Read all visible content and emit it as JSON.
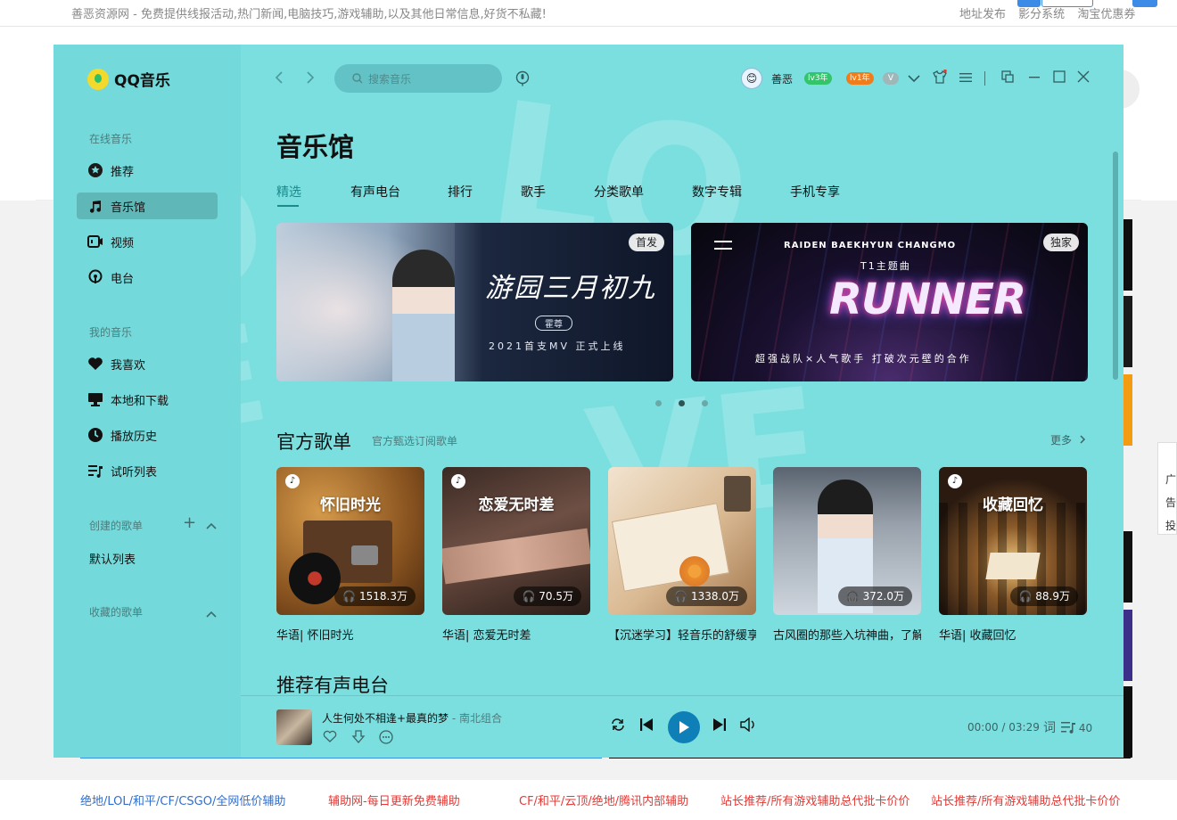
{
  "background": {
    "notice": "善恶资源网 - 免费提供线报活动,热门新闻,电脑技巧,游戏辅助,以及其他日常信息,好货不私藏!",
    "top_links": [
      "地址发布",
      "影分系统",
      "淘宝优惠券"
    ],
    "float_labels": [
      "广告",
      "投"
    ],
    "bottom_links": [
      {
        "text": "绝地/LOL/和平/CF/CSGO/全网低价辅助",
        "color": "#2f6fd1"
      },
      {
        "text": "辅助网-每日更新免费辅助",
        "color": "#e53935"
      },
      {
        "text": "CF/和平/云顶/绝地/腾讯内部辅助",
        "color": "#e53935"
      },
      {
        "text": "站长推荐/所有游戏辅助总代批卡价价",
        "color": "#e53935"
      },
      {
        "text": "站长推荐/所有游戏辅助总代批卡价价",
        "color": "#e53935"
      }
    ]
  },
  "app": {
    "name": "QQ音乐",
    "accent": "#1b8a8b",
    "window_bg": "#7bdfe0",
    "sidebar": {
      "section_online": "在线音乐",
      "online_items": [
        {
          "label": "推荐",
          "icon": "star-circle-icon"
        },
        {
          "label": "音乐馆",
          "icon": "music-note-icon",
          "active": true
        },
        {
          "label": "视频",
          "icon": "video-icon"
        },
        {
          "label": "电台",
          "icon": "radio-icon"
        }
      ],
      "section_mine": "我的音乐",
      "mine_items": [
        {
          "label": "我喜欢",
          "icon": "heart-icon"
        },
        {
          "label": "本地和下载",
          "icon": "monitor-icon"
        },
        {
          "label": "播放历史",
          "icon": "clock-icon"
        },
        {
          "label": "试听列表",
          "icon": "playlist-icon"
        }
      ],
      "section_created": "创建的歌单",
      "created_items": [
        "默认列表"
      ],
      "section_collected": "收藏的歌单"
    },
    "header": {
      "search_placeholder": "搜索音乐",
      "username": "善恶",
      "badges": [
        "lv3年",
        "lv1年"
      ]
    },
    "page_title": "音乐馆",
    "tabs": [
      "精选",
      "有声电台",
      "排行",
      "歌手",
      "分类歌单",
      "数字专辑",
      "手机专享"
    ],
    "banners": [
      {
        "tag": "首发",
        "title": "游园三月初九",
        "subtitle": "霍尊",
        "caption": "2021首支MV 正式上线"
      },
      {
        "tag": "独家",
        "artists": "RAIDEN   BAEKHYUN   CHANGMO",
        "subtitle": "T1主题曲",
        "title": "RUNNER",
        "caption": "超强战队×人气歌手  打破次元壁的合作"
      }
    ],
    "carousel_active": 1,
    "section_playlists": {
      "title": "官方歌单",
      "subtitle": "官方甄选订阅歌单",
      "more": "更多"
    },
    "playlists": [
      {
        "cover_title": "怀旧时光",
        "plays": "1518.3万",
        "label": "华语| 怀旧时光"
      },
      {
        "cover_title": "恋爱无时差",
        "plays": "70.5万",
        "label": "华语| 恋爱无时差"
      },
      {
        "cover_title": "",
        "plays": "1338.0万",
        "label": "【沉迷学习】轻音乐的舒缓享"
      },
      {
        "cover_title": "",
        "plays": "372.0万",
        "label": "古风圈的那些入坑神曲，了解"
      },
      {
        "cover_title": "收藏回忆",
        "plays": "88.9万",
        "label": "华语| 收藏回忆"
      }
    ],
    "section_radio": {
      "title": "推荐有声电台"
    },
    "player": {
      "song": "人生何处不相逢+最真的梦",
      "artist": "南北组合",
      "time": "00:00 / 03:29",
      "lyric_btn": "词",
      "playlist_count": "40"
    }
  }
}
